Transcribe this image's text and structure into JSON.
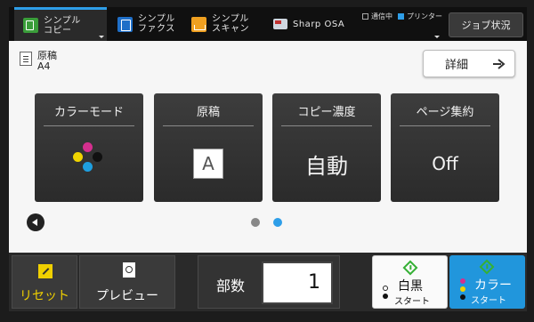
{
  "topbar": {
    "tabs": [
      {
        "label": "シンプル\nコピー",
        "icon": "copy-icon",
        "active": true
      },
      {
        "label": "シンプル\nファクス",
        "icon": "fax-icon"
      },
      {
        "label": "シンプル\nスキャン",
        "icon": "scan-icon"
      },
      {
        "label": "Sharp OSA",
        "icon": "osa-icon"
      }
    ],
    "status": {
      "sending": "通信中",
      "printer": "プリンター"
    },
    "job_status_label": "ジョブ状況",
    "accent_color": "#2e9ee8"
  },
  "original": {
    "title": "原稿",
    "size": "A4"
  },
  "detail_button": "詳細",
  "tiles": [
    {
      "title": "カラーモード",
      "icon": "cmyk-dots-icon"
    },
    {
      "title": "原稿",
      "value": "A"
    },
    {
      "title": "コピー濃度",
      "value": "自動"
    },
    {
      "title": "ページ集約",
      "value": "Off"
    }
  ],
  "pagination": {
    "pages": 2,
    "current": 2
  },
  "bottom": {
    "reset_label": "リセット",
    "preview_label": "プレビュー",
    "copies_label": "部数",
    "copies_value": "1",
    "bw_start": {
      "line1": "白黒",
      "line2": "スタート"
    },
    "color_start": {
      "line1": "カラー",
      "line2": "スタート"
    }
  },
  "colors": {
    "cyan": "#1e9fe0",
    "magenta": "#d42f8e",
    "yellow": "#f0d400",
    "black": "#111111",
    "start_green": "#35b035",
    "reset_yellow": "#f0d000",
    "color_start_bg": "#2196dc"
  }
}
